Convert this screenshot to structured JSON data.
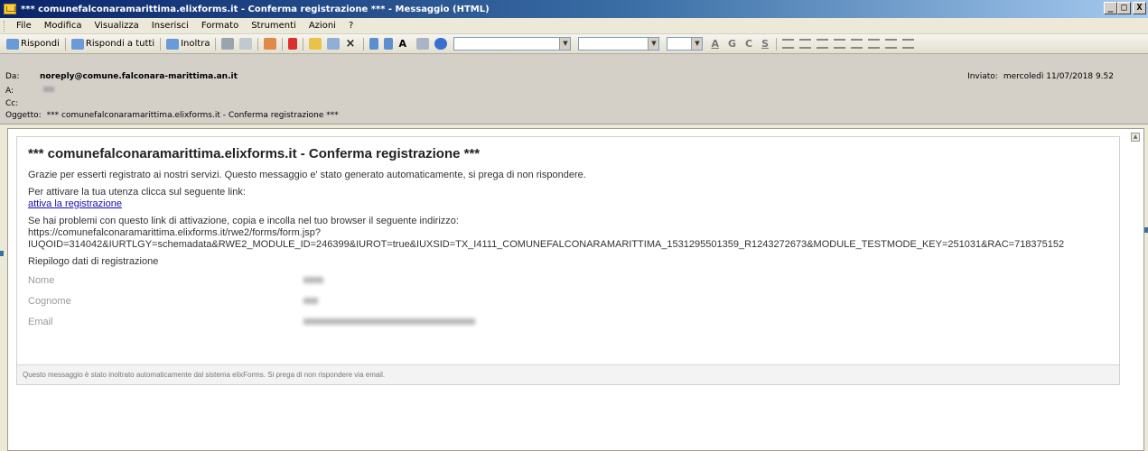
{
  "window": {
    "title": "*** comunefalconaramarittima.elixforms.it - Conferma registrazione *** - Messaggio (HTML)",
    "buttons": [
      "_",
      "×",
      "X"
    ]
  },
  "menu": {
    "items": [
      "File",
      "Modifica",
      "Visualizza",
      "Inserisci",
      "Formato",
      "Strumenti",
      "Azioni",
      "?"
    ]
  },
  "toolbar": {
    "reply_label": "Rispondi",
    "reply_all_label": "Rispondi a tutti",
    "forward_label": "Inoltra",
    "bold": "G",
    "italic": "C",
    "underline": "S"
  },
  "header": {
    "from_label": "Da:",
    "from_value": "noreply@comune.falconara-marittima.an.it",
    "to_label": "A:",
    "cc_label": "Cc:",
    "subject_label": "Oggetto:",
    "subject_value": "*** comunefalconaramarittima.elixforms.it - Conferma registrazione ***",
    "sent_label": "Inviato:",
    "sent_value": "mercoledì 11/07/2018 9.52"
  },
  "mail": {
    "title": "*** comunefalconaramarittima.elixforms.it - Conferma registrazione ***",
    "intro": "Grazie per esserti registrato ai nostri servizi. Questo messaggio e' stato generato automaticamente, si prega di non rispondere.",
    "activate_text": "Per attivare la tua utenza clicca sul seguente link:",
    "activate_link": "attiva la registrazione",
    "problems_text": "Se hai problemi con questo link di attivazione, copia e incolla nel tuo browser il seguente indirizzo:",
    "url_line1": "https://comunefalconaramarittima.elixforms.it/rwe2/forms/form.jsp?",
    "url_line2": "IUQOID=314042&IURTLGY=schemadata&RWE2_MODULE_ID=246399&IUROT=true&IUXSID=TX_I4111_COMUNEFALCONARAMARITTIMA_1531295501359_R1243272673&MODULE_TESTMODE_KEY=251031&RAC=718375152",
    "summary_title": "Riepilogo dati di registrazione",
    "fields": [
      {
        "label": "Nome"
      },
      {
        "label": "Cognome"
      },
      {
        "label": "Email"
      }
    ],
    "footer": "Questo messaggio è stato inoltrato automaticamente dal sistema elixForms. Si prega di non rispondere via email."
  }
}
